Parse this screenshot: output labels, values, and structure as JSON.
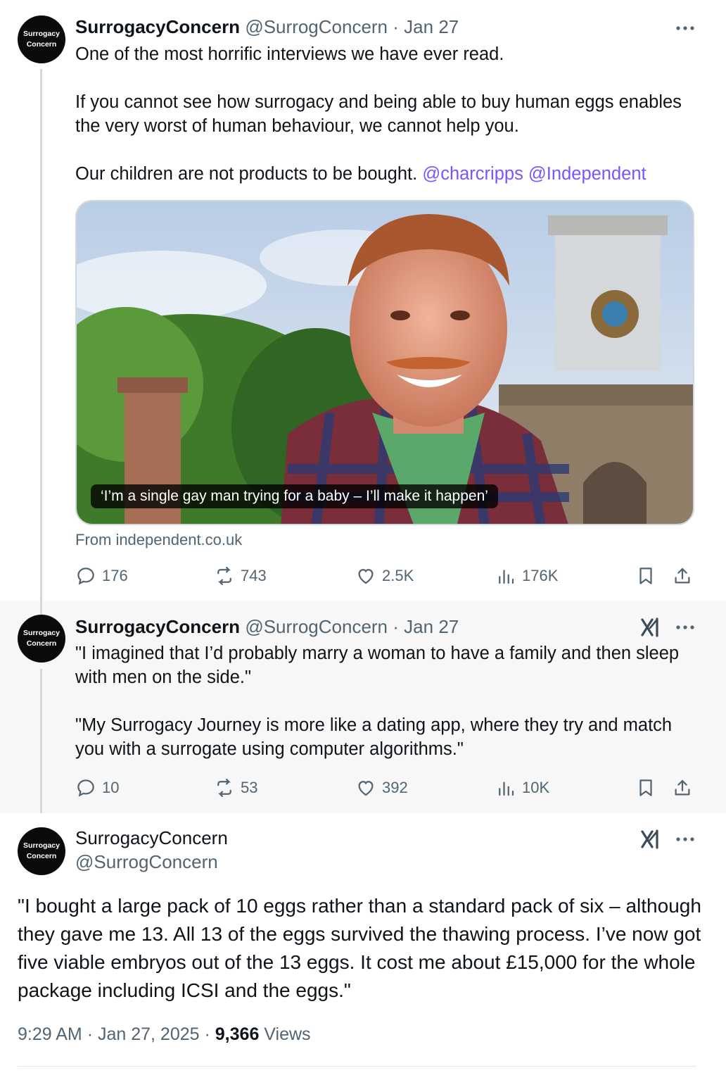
{
  "accent_color": "#7856ff",
  "avatar": {
    "line1": "Surrogacy",
    "line2": "Concern"
  },
  "tweets": [
    {
      "name": "SurrogacyConcern",
      "handle": "@SurrogConcern",
      "separator": "·",
      "date": "Jan 27",
      "text_lines": [
        "One of the most horrific interviews we have ever read.",
        "If you cannot see how surrogacy and being able to buy human eggs enables the very worst of human behaviour, we cannot help you.",
        "Our children are not products to be bought."
      ],
      "mentions": [
        "@charcripps",
        "@Independent"
      ],
      "card": {
        "caption": "‘I’m a single gay man trying for a baby – I’ll make it happen’",
        "source": "From independent.co.uk"
      },
      "actions": {
        "replies": "176",
        "reposts": "743",
        "likes": "2.5K",
        "views": "176K"
      }
    },
    {
      "name": "SurrogacyConcern",
      "handle": "@SurrogConcern",
      "separator": "·",
      "date": "Jan 27",
      "text_lines": [
        "\"I imagined that I’d probably marry a woman to have a family and then sleep with men on the side.\"",
        "\"My Surrogacy Journey is more like a dating app, where they try and match you with a surrogate using computer algorithms.\""
      ],
      "actions": {
        "replies": "10",
        "reposts": "53",
        "likes": "392",
        "views": "10K"
      }
    },
    {
      "name": "SurrogacyConcern",
      "handle": "@SurrogConcern",
      "text": "\"I bought a large pack of 10 eggs rather than a standard pack of six – although they gave me 13. All 13 of the eggs survived the thawing process. I’ve now got five viable embryos out of the 13 eggs. It cost me about £15,000 for the whole package including ICSI and the eggs.\"",
      "time": "9:29 AM",
      "separator": "·",
      "full_date": "Jan 27, 2025",
      "views_count": "9,366",
      "views_label": "Views"
    }
  ]
}
